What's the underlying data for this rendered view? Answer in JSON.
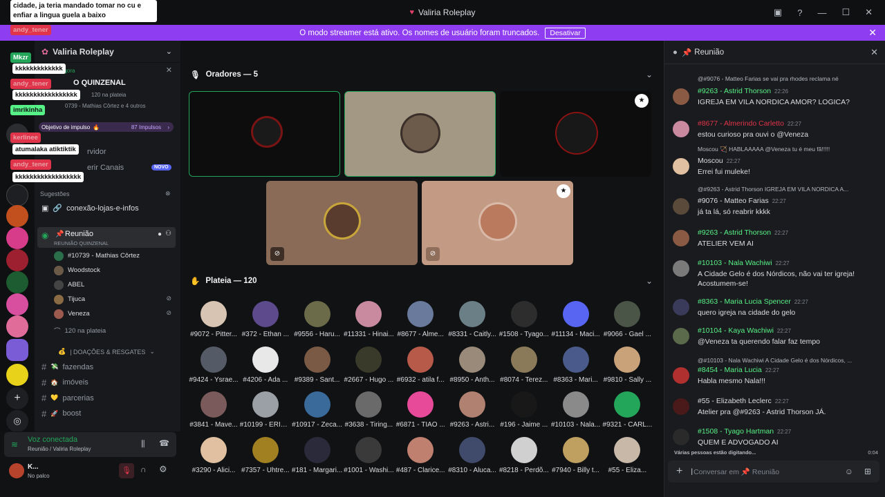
{
  "window": {
    "title": "Valiria Roleplay"
  },
  "banner": {
    "text": "O modo streamer está ativo. Os nomes de usuário foram truncados.",
    "button": "Desativar"
  },
  "server": {
    "name": "Valiria Roleplay"
  },
  "event": {
    "time": "agora",
    "title": "O QUINZENAL",
    "count": "120 na plateia",
    "people": "0739 - Mathias Côrtez e 4 outros"
  },
  "boost": {
    "label": "Objetivo de impulso",
    "value": "87 Impulsos"
  },
  "misc": {
    "server_row": "rvidor",
    "channels_row": "erir Canais",
    "novo": "NOVO"
  },
  "suggestions": {
    "label": "Sugestões",
    "channel": "conexão-lojas-e-infos"
  },
  "voice_channel": {
    "name": "Reunião",
    "subtitle": "REUNIÃO QUINZENAL",
    "members": [
      "#10739 - Mathias Côrtez",
      "Woodstock",
      "ABEL",
      "Tijuca",
      "Veneza"
    ],
    "audience": "120 na plateia"
  },
  "category": {
    "name": "| DOAÇÕES & RESGATES",
    "channels": [
      "fazendas",
      "imóveis",
      "parcerias",
      "boost"
    ]
  },
  "voice_status": {
    "title": "Voz conectada",
    "location": "Reunião / Valiria Roleplay"
  },
  "user": {
    "name": "K...",
    "status": "No palco"
  },
  "stage": {
    "speakers_label": "Oradores — 5",
    "audience_label": "Plateia — 120"
  },
  "audience": [
    "#9072 - Pitter...",
    "#372 - Ethan ...",
    "#9556 - Haru...",
    "#11331 - Hinai...",
    "#8677 - Alme...",
    "#8331 - Caitly...",
    "#1508 - Tyago...",
    "#11134 - Maci...",
    "#9066 - Gael ...",
    "#9424 - Ysrae...",
    "#4206 - Ada ...",
    "#9389 - Sant...",
    "#2667 - Hugo ...",
    "#6932 - atila f...",
    "#8950 - Anth...",
    "#8074 - Terez...",
    "#8363 - Mari...",
    "#9810 - Sally ...",
    "#3841 - Mave...",
    "#10199 - ERIC...",
    "#10917 - Zeca...",
    "#3638 - Tiring...",
    "#6871 - TIAO ...",
    "#9263 - Astri...",
    "#196 - Jaime ...",
    "#10103 - Nala...",
    "#9321 - CARL...",
    "#3290 - Alici...",
    "#7357 - Uhtre...",
    "#181 - Margari...",
    "#1001 - Washi...",
    "#487 - Clarice...",
    "#8310 - Aluca...",
    "#8218 - Perdõ...",
    "#7940 - Billy t...",
    "#55 - Eliza..."
  ],
  "chat": {
    "title": "Reunião",
    "placeholder": "Conversar em 📌 Reunião",
    "typing": "Várias pessoas estão digitando...",
    "typing_time": "0:04",
    "messages": [
      {
        "reply": "@#9076 - Matteo Farias se vai pra rhodes reclama né",
        "name": "#9263 - Astrid Thorson",
        "time": "22:26",
        "text": "IGREJA EM VILA NORDICA AMOR? LOGICA?",
        "color": "#57f287"
      },
      {
        "reply": "",
        "name": "#8677 - Almerindo Carletto",
        "time": "22:27",
        "text": "estou curioso pra ouvi o @Veneza",
        "color": "#e0344a"
      },
      {
        "reply": "Moscou 🏹 HABLAAAAA @Veneza tu é meu fã!!!!!",
        "name": "Moscou",
        "time": "22:27",
        "text": "Errei fui muleke!",
        "color": "#dbdee1"
      },
      {
        "reply": "@#9263 - Astrid Thorson IGREJA EM VILA NORDICA A...",
        "name": "#9076 - Matteo Farias",
        "time": "22:27",
        "text": "já ta lá, só reabrir kkkk",
        "color": "#dbdee1"
      },
      {
        "reply": "",
        "name": "#9263 - Astrid Thorson",
        "time": "22:27",
        "text": "ATELIER VEM AI",
        "color": "#57f287"
      },
      {
        "reply": "",
        "name": "#10103 - Nala Wachiwi",
        "time": "22:27",
        "text": "A Cidade Gelo é dos Nórdicos, não vai ter igreja! Acostumem-se!",
        "color": "#57f287"
      },
      {
        "reply": "",
        "name": "#8363 - Maria Lucia Spencer",
        "time": "22:27",
        "text": "quero igreja na cidade do gelo",
        "color": "#57f287"
      },
      {
        "reply": "",
        "name": "#10104 - Kaya Wachiwi",
        "time": "22:27",
        "text": "@Veneza ta querendo falar faz tempo",
        "color": "#57f287"
      },
      {
        "reply": "@#10103 - Nala Wachiwi A Cidade Gelo é dos Nórdicos, ...",
        "name": "#8454 - Maria Lucia",
        "time": "22:27",
        "text": "Habla mesmo Nala!!!",
        "color": "#57f287"
      },
      {
        "reply": "",
        "name": "#55 - Elizabeth Leclerc",
        "time": "22:27",
        "text": "Atelier pra @#9263 - Astrid Thorson JÁ.",
        "color": "#dbdee1"
      },
      {
        "reply": "",
        "name": "#1508 - Tyago Hartman",
        "time": "22:27",
        "text": "QUEM E ADVOGADO AI",
        "color": "#57f287"
      }
    ]
  },
  "overlay": {
    "top_msg": "cidade, ja teria mandado tomar no cu e enfiar a lingua guela a baixo",
    "lines": [
      "andy_tener",
      "Mkzr",
      "kkkkkkkkkkkkk",
      "andy_tener",
      "kkkkkkkkkkkkkkkkk",
      "imrikinha",
      "kerlinee",
      "atumalaka atiktiktik",
      "andy_tener",
      "kkkkkkkkkkkkkkkkkk"
    ]
  },
  "colors": {
    "accent": "#8f3df0",
    "green": "#23a55a",
    "red": "#e0344a",
    "blurple": "#5865f2"
  }
}
